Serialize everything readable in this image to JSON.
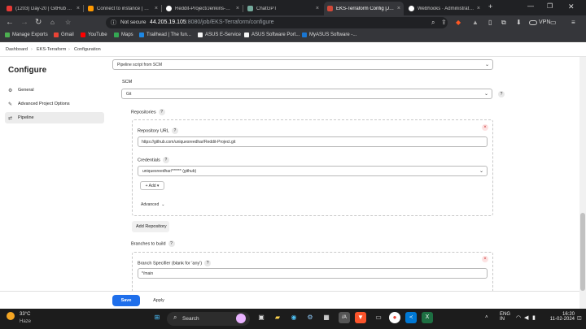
{
  "browser": {
    "tabs": [
      {
        "title": "(1203) Day-20 | GitHub Actions",
        "color": "#e53935"
      },
      {
        "title": "Connect to instance | EC2 | us-",
        "color": "#f90"
      },
      {
        "title": "Reddit-Project/Jenkins-Pipeline",
        "color": "#fff"
      },
      {
        "title": "ChatGPT",
        "color": "#74aa9c"
      },
      {
        "title": "EKS-Terraform Config [Jenkins]",
        "color": "#d24939"
      },
      {
        "title": "Webhooks · Administration",
        "color": "#fff"
      }
    ],
    "new_tab": "+",
    "close": "×",
    "omnibox": {
      "not_secure": "Not secure",
      "host": "44.205.19.105",
      "path": ":8080/job/EKS-Terraform/configure"
    },
    "vpn": "VPN",
    "bookmarks": [
      "Manage Exports",
      "Gmail",
      "YouTube",
      "Maps",
      "Trailhead | The fun...",
      "ASUS E-Service",
      "ASUS Software Port...",
      "MyASUS Software -..."
    ]
  },
  "breadcrumb": [
    "Dashboard",
    "EKS-Terraform",
    "Configuration"
  ],
  "sidebar": {
    "title": "Configure",
    "items": [
      {
        "label": "General",
        "icon": "gear-icon"
      },
      {
        "label": "Advanced Project Options",
        "icon": "wrench-icon"
      },
      {
        "label": "Pipeline",
        "icon": "pipeline-icon"
      }
    ]
  },
  "form": {
    "definition_value": "Pipeline script from SCM",
    "scm_label": "SCM",
    "scm_value": "Git",
    "repositories_label": "Repositories",
    "repo_url_label": "Repository URL",
    "repo_url_value": "https://github.com/uniquesreedhar/Reddit-Project.git",
    "credentials_label": "Credentials",
    "credentials_value": "uniquesreedhar/****** (github)",
    "add_button": "+ Add ▾",
    "advanced_label": "Advanced",
    "add_repository": "Add Repository",
    "branches_label": "Branches to build",
    "branch_spec_label": "Branch Specifier (blank for 'any')",
    "branch_spec_value": "*/main",
    "help": "?"
  },
  "actions": {
    "save": "Save",
    "apply": "Apply"
  },
  "taskbar": {
    "weather_temp": "33°C",
    "weather_text": "Haze",
    "search_placeholder": "Search",
    "lang1": "ENG",
    "lang2": "IN",
    "time": "16:20",
    "date": "11-02-2024"
  },
  "colors": {
    "save_blue": "#1f6feb",
    "page_bg": "#ffffff",
    "chrome_dark": "#202124"
  }
}
